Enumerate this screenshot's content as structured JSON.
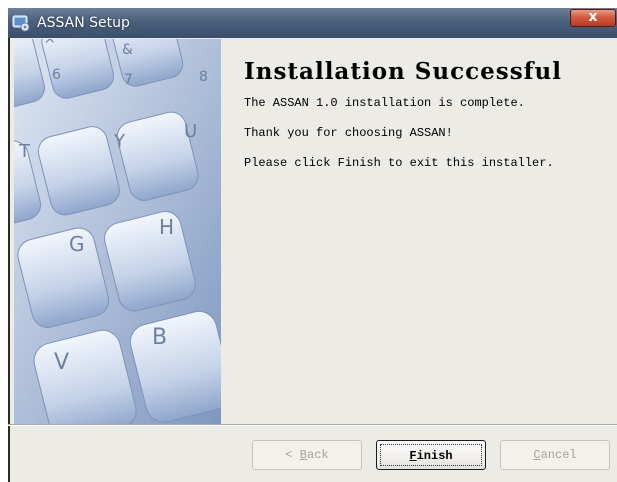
{
  "window": {
    "title": "ASSAN Setup",
    "close_label": "x"
  },
  "main": {
    "heading": "Installation Successful",
    "line1": "The ASSAN 1.0 installation is complete.",
    "line2": "Thank you for choosing ASSAN!",
    "line3": "Please click Finish to exit this installer."
  },
  "keyboard_keys": [
    "^",
    "&",
    "6",
    "7",
    "8",
    "T",
    "Y",
    "U",
    "G",
    "H",
    "V",
    "B"
  ],
  "buttons": {
    "back_prefix": "< ",
    "back_hotkey": "B",
    "back_rest": "ack",
    "finish_hotkey": "F",
    "finish_rest": "inish",
    "cancel_hotkey": "C",
    "cancel_rest": "ancel"
  },
  "colors": {
    "titlebar": "#4b607c",
    "close": "#d35a3f",
    "dialog_bg": "#ecebe6",
    "keys": "#c9d6ea"
  }
}
